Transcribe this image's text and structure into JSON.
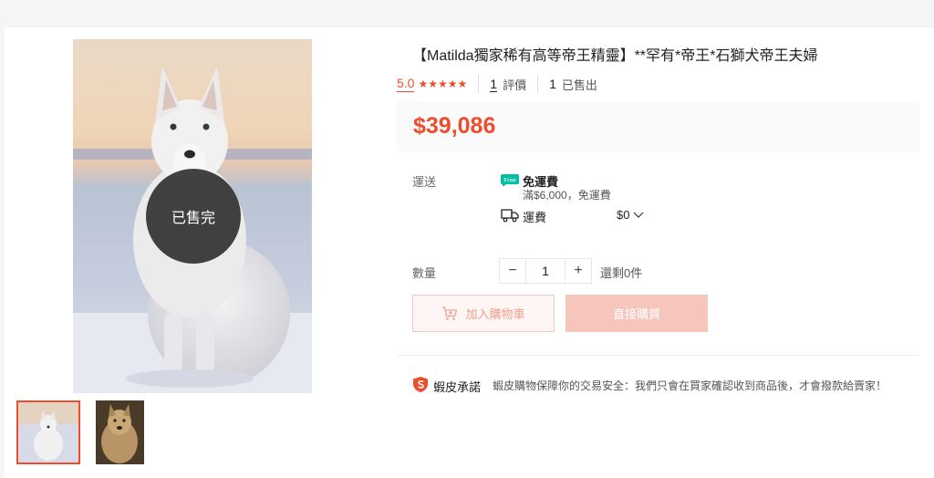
{
  "product": {
    "title": "【Matilda獨家稀有高等帝王精靈】**罕有*帝王*石獅犬帝王夫婦",
    "rating": "5.0",
    "stars": "★★★★★",
    "review_count": "1",
    "review_label": "評價",
    "sold_count": "1",
    "sold_label": "已售出",
    "price": "$39,086",
    "soldout_badge": "已售完"
  },
  "shipping": {
    "label": "運送",
    "free_badge": "Free",
    "free_title": "免運費",
    "free_condition": "滿$6,000，免運費",
    "fee_label": "運費",
    "fee_value": "$0"
  },
  "quantity": {
    "label": "數量",
    "minus": "−",
    "value": "1",
    "plus": "+",
    "stock": "還剩0件"
  },
  "actions": {
    "add_to_cart": "加入購物車",
    "buy_now": "直接購買"
  },
  "guarantee": {
    "title": "蝦皮承諾",
    "text": "蝦皮購物保障你的交易安全：我們只會在買家確認收到商品後，才會撥款給賣家！"
  },
  "colors": {
    "accent": "#ee4d2d",
    "free_green": "#00bfa5"
  },
  "icons": {
    "free_shipping": "free-shipping-icon",
    "truck": "truck-icon",
    "cart": "cart-plus-icon",
    "shield": "shopee-guarantee-icon",
    "chevron": "chevron-down-icon"
  }
}
